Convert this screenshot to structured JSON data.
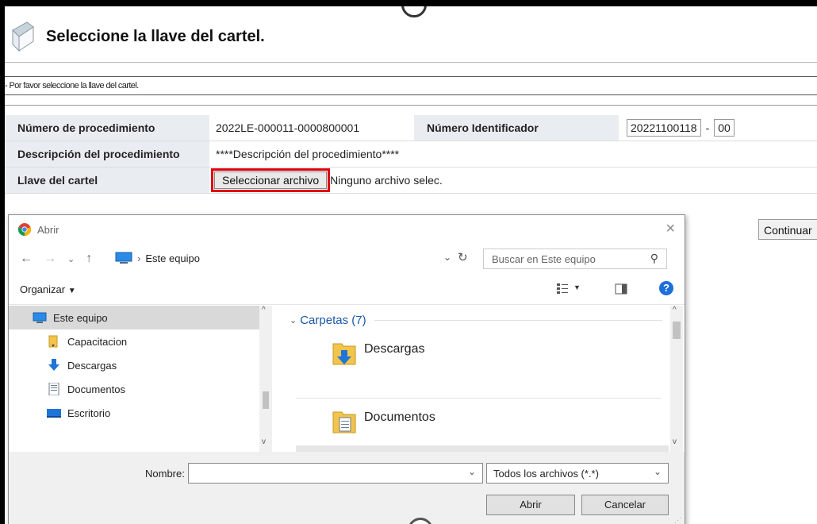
{
  "page": {
    "title": "Seleccione la llave del cartel.",
    "instruction": "- Por favor seleccione la llave del cartel.",
    "fields": {
      "procedure_number_label": "Número de procedimiento",
      "procedure_number_value": "2022LE-000011-0000800001",
      "identifier_label": "Número Identificador",
      "identifier_value": "20221100118",
      "identifier_dash": "-",
      "identifier_suffix": "00",
      "description_label": "Descripción del procedimiento",
      "description_value": "****Descripción del procedimiento****",
      "key_label": "Llave del cartel",
      "file_button": "Seleccionar archivo",
      "file_status": "Ninguno archivo selec."
    },
    "continue_button": "Continuar"
  },
  "dialog": {
    "title": "Abrir",
    "path": "Este equipo",
    "search_placeholder": "Buscar en Este equipo",
    "organize": "Organizar",
    "help": "?",
    "nav_items": [
      {
        "label": "Este equipo"
      },
      {
        "label": "Capacitacion"
      },
      {
        "label": "Descargas"
      },
      {
        "label": "Documentos"
      },
      {
        "label": "Escritorio"
      }
    ],
    "group_label": "Carpetas (7)",
    "folders": [
      {
        "name": "Descargas"
      },
      {
        "name": "Documentos"
      }
    ],
    "name_label": "Nombre:",
    "name_value": "",
    "file_type": "Todos los archivos (*.*)",
    "open_button": "Abrir",
    "cancel_button": "Cancelar"
  },
  "colors": {
    "highlight": "#e0000f",
    "label_bg": "#e9edf1",
    "link_blue": "#1a56a6"
  }
}
